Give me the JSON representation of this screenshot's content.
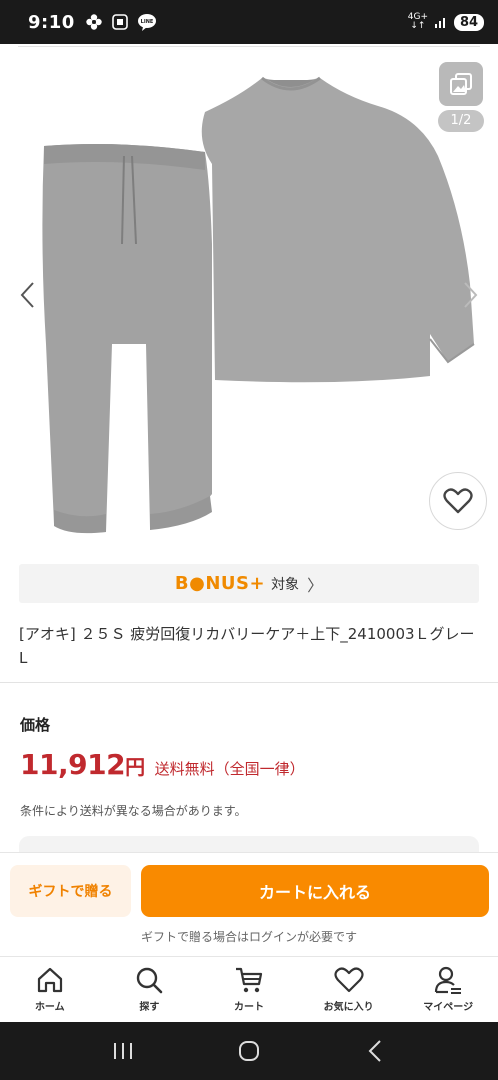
{
  "status_bar": {
    "time": "9:10",
    "network": "4G+",
    "battery": "84"
  },
  "gallery": {
    "page_indicator": "1/2"
  },
  "bonus": {
    "logo": "B●NUS+",
    "text": "対象",
    "chevron": "〉"
  },
  "product": {
    "name": "[アオキ] ２５Ｓ 疲労回復リカバリーケア＋上下_2410003Ｌグレー L"
  },
  "price": {
    "label": "価格",
    "amount": "11,912",
    "currency": "円",
    "shipping": "送料無料（全国一律）",
    "note": "条件により送料が異なる場合があります。"
  },
  "actions": {
    "gift_button": "ギフトで贈る",
    "cart_button": "カートに入れる",
    "gift_note": "ギフトで贈る場合はログインが必要です"
  },
  "bottom_nav": {
    "items": [
      {
        "label": "ホーム",
        "icon": "home-icon"
      },
      {
        "label": "探す",
        "icon": "search-icon"
      },
      {
        "label": "カート",
        "icon": "cart-icon"
      },
      {
        "label": "お気に入り",
        "icon": "heart-icon"
      },
      {
        "label": "マイページ",
        "icon": "user-icon"
      }
    ]
  },
  "colors": {
    "accent": "#f98a00",
    "price_red": "#c0292e",
    "garment_gray": "#a4a4a4"
  }
}
